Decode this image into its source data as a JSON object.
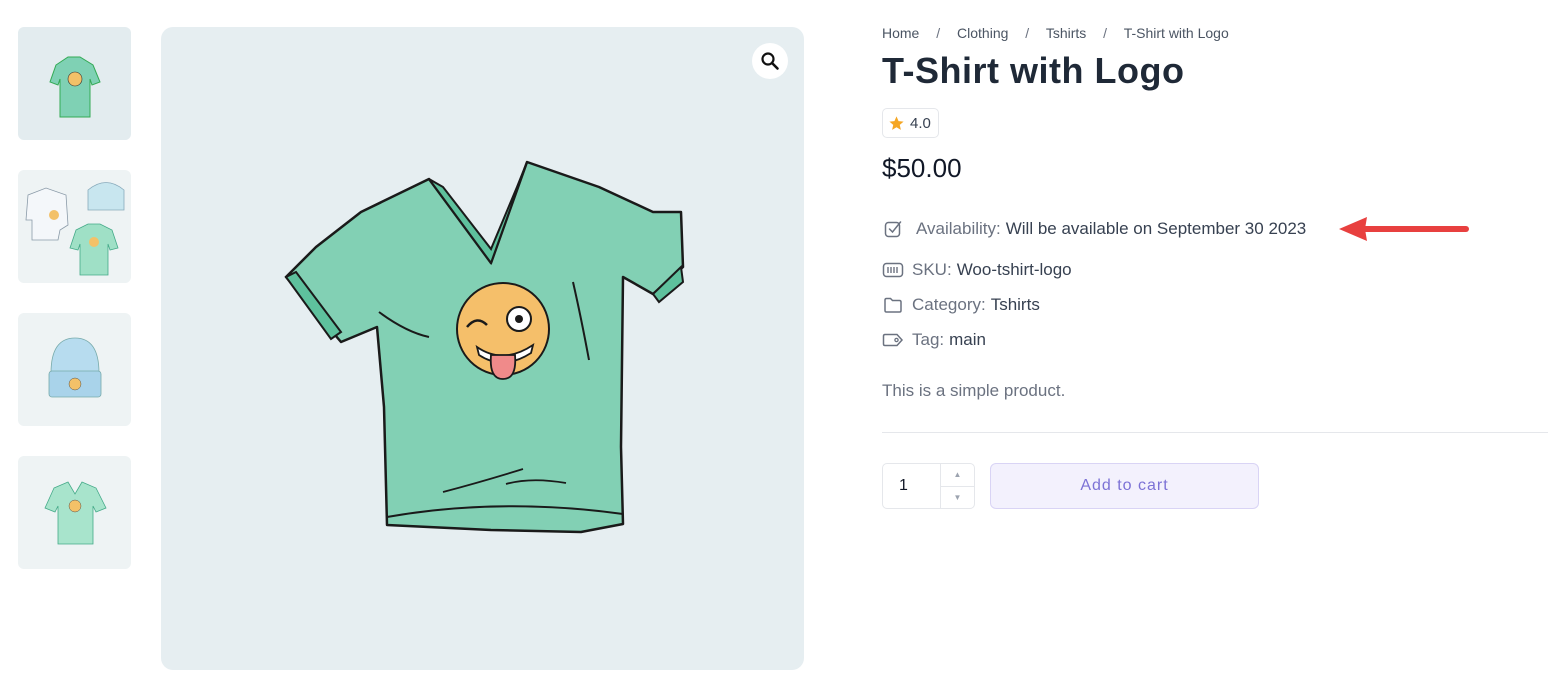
{
  "breadcrumb": {
    "items": [
      "Home",
      "Clothing",
      "Tshirts",
      "T-Shirt with Logo"
    ],
    "separator": "/"
  },
  "product": {
    "title": "T-Shirt with Logo",
    "rating": "4.0",
    "price": "$50.00",
    "availability_label": "Availability:",
    "availability_value": "Will be available on September 30 2023",
    "sku_label": "SKU:",
    "sku_value": "Woo-tshirt-logo",
    "category_label": "Category:",
    "category_value": "Tshirts",
    "tag_label": "Tag:",
    "tag_value": "main",
    "description": "This is a simple product."
  },
  "cart": {
    "quantity": "1",
    "add_to_cart_label": "Add to cart"
  },
  "icons": {
    "zoom": "search-icon",
    "rating": "star-icon",
    "availability": "check-square-icon",
    "sku": "barcode-icon",
    "category": "folder-icon",
    "tag": "tag-icon",
    "annotation": "red-arrow-icon"
  },
  "colors": {
    "accent": "#7c72d6",
    "star": "#f5a623",
    "arrow": "#e8403f",
    "image_bg": "#e6eef1"
  }
}
